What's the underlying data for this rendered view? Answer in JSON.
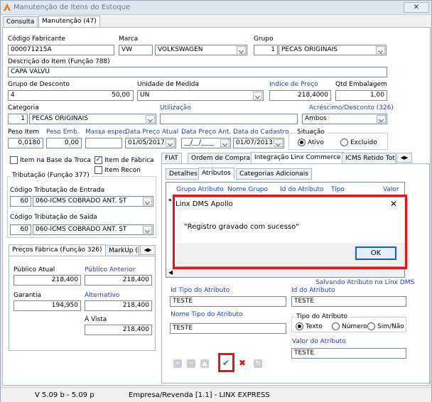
{
  "window": {
    "title": "Manutenção de Itens do Estoque",
    "close_label": "✕"
  },
  "top_tabs": [
    {
      "label": "Consulta"
    },
    {
      "label": "Manutenção (47)"
    }
  ],
  "fields": {
    "codigo_fabricante": {
      "label": "Código Fabricante",
      "value": "000071215A"
    },
    "marca": {
      "label": "Marca",
      "code": "VW",
      "name": "VOLKSWAGEN"
    },
    "grupo": {
      "label": "Grupo",
      "code": "1",
      "name": "PECAS ORIGINAIS"
    },
    "descricao": {
      "label": "Descrição do Item (Função 788)",
      "value": "CAPA VALVU"
    },
    "grupo_desconto": {
      "label": "Grupo de Desconto",
      "code": "4",
      "value": "50,00"
    },
    "unidade": {
      "label": "Unidade de Medida",
      "value": "UN"
    },
    "indice_preco": {
      "label": "Indice de Preço",
      "value": "218,4000"
    },
    "qtd_embalagem": {
      "label": "Qtd Embalagem",
      "value": "1,00"
    },
    "categoria": {
      "label": "Categoria",
      "code": "1",
      "name": "PECAS ORIGINAIS"
    },
    "utilizacao": {
      "label": "Utilização",
      "value": ""
    },
    "acrescimo": {
      "label": "Acréscimo/Desconto (326)",
      "value": "Ambos"
    },
    "peso_item": {
      "label": "Peso Item",
      "value": "0,0180"
    },
    "peso_emb": {
      "label": "Peso Emb.",
      "value": "0,00"
    },
    "massa_espec": {
      "label": "Massa espec.",
      "value": ""
    },
    "data_preco_atual": {
      "label": "Data Preço Atual",
      "value": "01/05/2017"
    },
    "data_preco_ant": {
      "label": "Data Preço Ant.",
      "value": "__/__/____"
    },
    "data_cadastro": {
      "label": "Data do Cadastro",
      "value": "01/07/2013"
    },
    "situacao": {
      "label": "Situação",
      "ativo": "Ativo",
      "excluido": "Excluído"
    }
  },
  "checkboxes": {
    "base_troca": "Item na Base da Troca",
    "item_fabrica": "Item de Fábrica",
    "item_recon": "Item Recon"
  },
  "tributacao": {
    "title": "Tributação (Função 377)",
    "entrada_label": "Código Tributação de Entrada",
    "entrada_code": "60",
    "entrada_name": "060-ICMS COBRADO ANT. ST",
    "saida_label": "Código Tributação de Saida",
    "saida_code": "60",
    "saida_name": "060-ICMS COBRADO ANT. ST"
  },
  "precos": {
    "tabs": [
      {
        "label": "Preços Fábrica (Função 326)"
      },
      {
        "label": "MarkUp (Fu"
      }
    ],
    "publico_atual_label": "Público Atual",
    "publico_atual": "218,400",
    "publico_anterior_label": "Público Anterior",
    "publico_anterior": "218,400",
    "garantia_label": "Garantia",
    "garantia": "194,950",
    "alternativo_label": "Alternativo",
    "alternativo": "218,400",
    "avista_label": "À Vista",
    "avista": "218,400"
  },
  "right_tabs": [
    {
      "label": "FIAT"
    },
    {
      "label": "Ordem de Compra"
    },
    {
      "label": "Integração Linx Commerce"
    },
    {
      "label": "ICMS Retido Tot"
    }
  ],
  "sub_tabs": [
    {
      "label": "Detalhes"
    },
    {
      "label": "Atributos"
    },
    {
      "label": "Categorias Adicionais"
    }
  ],
  "grid": {
    "columns": [
      "Grupo Atributo",
      "Nome Grupo",
      "Id do Atributo",
      "Tipo",
      "Valor"
    ],
    "row_marker": "*"
  },
  "dialog": {
    "title": "Linx DMS Apollo",
    "message": "\"Registro gravado com sucesso\"",
    "ok_label": "OK",
    "close_label": "✕"
  },
  "attr_form": {
    "saving_text": "Salvando Atributo no Linx DMS",
    "id_tipo_label": "Id Tipo do Atributo",
    "id_tipo": "TESTE",
    "id_atributo_label": "Id do Atributo",
    "id_atributo": "TESTE",
    "nome_tipo_label": "Nome Tipo do Atributo",
    "nome_tipo": "TESTE",
    "tipo_label": "Tipo do Atributo",
    "texto": "Texto",
    "numero": "Número",
    "simnao": "Sim/Não",
    "valor_label": "Valor do Atributo",
    "valor": "TESTE"
  },
  "status": {
    "version": "V 5.09 b  -  5.09 p",
    "empresa": "Empresa/Revenda [1.1] - LINX EXPRESS"
  },
  "colors": {
    "highlight": "#e0161e",
    "link": "#1a3fd1"
  }
}
